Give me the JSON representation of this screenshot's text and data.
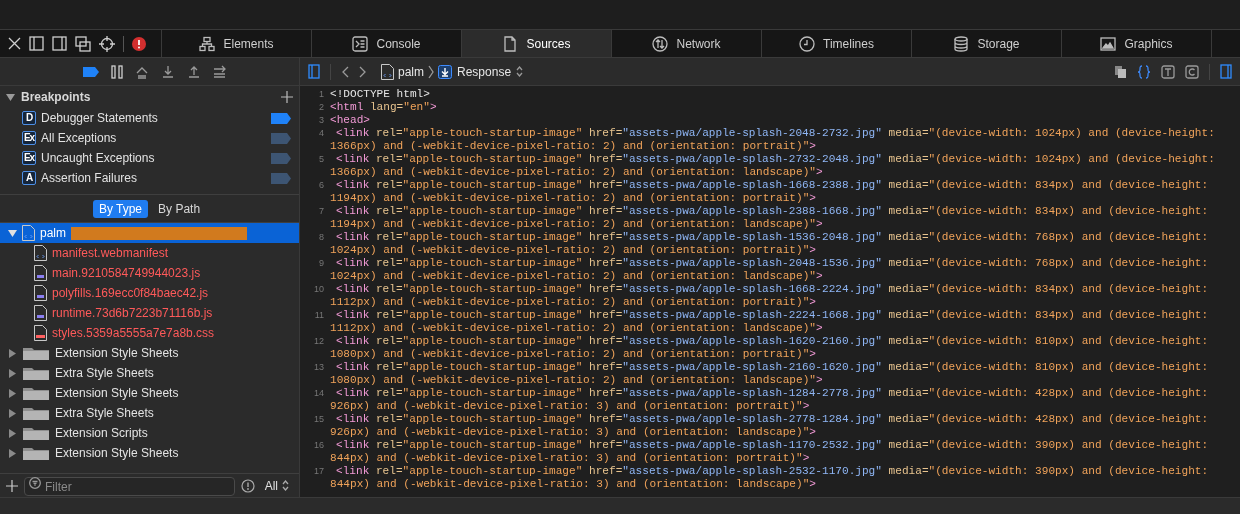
{
  "tabs": [
    {
      "label": "Elements",
      "selected": false
    },
    {
      "label": "Console",
      "selected": false
    },
    {
      "label": "Sources",
      "selected": true
    },
    {
      "label": "Network",
      "selected": false
    },
    {
      "label": "Timelines",
      "selected": false
    },
    {
      "label": "Storage",
      "selected": false
    },
    {
      "label": "Graphics",
      "selected": false
    }
  ],
  "navigation": {
    "breadcrumb": "palm",
    "mode": "Response"
  },
  "breakpoints": {
    "title": "Breakpoints",
    "expanded": true,
    "items": [
      {
        "badge": "D",
        "label": "Debugger Statements",
        "enabled": true
      },
      {
        "badge": "Ex",
        "label": "All Exceptions",
        "enabled": false
      },
      {
        "badge": "Ex",
        "label": "Uncaught Exceptions",
        "enabled": false
      },
      {
        "badge": "A",
        "label": "Assertion Failures",
        "enabled": false
      }
    ]
  },
  "grouping": [
    {
      "label": "By Type",
      "selected": true
    },
    {
      "label": "By Path",
      "selected": false
    }
  ],
  "tree": [
    {
      "label": "palm",
      "kind": "html",
      "selected": true,
      "expanded": true,
      "children": [
        {
          "label": "manifest.webmanifest",
          "kind": "html"
        },
        {
          "label": "main.9210584749944023.js",
          "kind": "js"
        },
        {
          "label": "polyfills.169ecc0f84baec42.js",
          "kind": "js"
        },
        {
          "label": "runtime.73d6b7223b71116b.js",
          "kind": "js"
        },
        {
          "label": "styles.5359a5555a7e7a8b.css",
          "kind": "css"
        }
      ]
    },
    {
      "label": "Extension Style Sheets",
      "kind": "folder",
      "selected": false,
      "expanded": false
    },
    {
      "label": "Extra Style Sheets",
      "kind": "folder",
      "selected": false,
      "expanded": false
    },
    {
      "label": "Extension Style Sheets",
      "kind": "folder",
      "selected": false,
      "expanded": false
    },
    {
      "label": "Extra Style Sheets",
      "kind": "folder",
      "selected": false,
      "expanded": false
    },
    {
      "label": "Extension Scripts",
      "kind": "folder",
      "selected": false,
      "expanded": false
    },
    {
      "label": "Extension Style Sheets",
      "kind": "folder",
      "selected": false,
      "expanded": false
    }
  ],
  "filter": {
    "placeholder": "Filter",
    "scope": "All"
  },
  "code": [
    {
      "number": "1",
      "kind": "plain",
      "rows": [
        {
          "segments": [
            {
              "kind": "plain",
              "text": "<!DOCTYPE html>"
            }
          ]
        }
      ]
    },
    {
      "number": "2",
      "kind": "plain",
      "rows": [
        {
          "segments": [
            {
              "kind": "tag",
              "text": "<html"
            },
            {
              "kind": "attribute",
              "text": " lang="
            },
            {
              "kind": "string",
              "text": "\"en\""
            },
            {
              "kind": "tag",
              "text": ">"
            }
          ]
        }
      ]
    },
    {
      "number": "3",
      "kind": "plain",
      "rows": [
        {
          "segments": [
            {
              "kind": "tag",
              "text": "<head>"
            }
          ]
        }
      ]
    },
    {
      "number": "4",
      "kind": "link",
      "rows": [
        {
          "segments": [
            {
              "kind": "tag",
              "text": "<link"
            },
            {
              "kind": "attribute",
              "text": " rel="
            },
            {
              "kind": "string",
              "text": "\"apple-touch-startup-image\""
            },
            {
              "kind": "attribute",
              "text": " href="
            },
            {
              "kind": "url",
              "text": "\"assets-pwa/apple-splash-2048-2732.jpg\""
            },
            {
              "kind": "attribute",
              "text": " media="
            },
            {
              "kind": "string",
              "text": "\"(device-width: 1024px) and (device-height:"
            }
          ]
        },
        {
          "segments": [
            {
              "kind": "string",
              "text": "1366px) and (-webkit-device-pixel-ratio: 2) and (orientation: portrait)\""
            },
            {
              "kind": "tag",
              "text": ">"
            }
          ]
        }
      ]
    },
    {
      "number": "5",
      "kind": "link",
      "rows": [
        {
          "segments": [
            {
              "kind": "tag",
              "text": "<link"
            },
            {
              "kind": "attribute",
              "text": " rel="
            },
            {
              "kind": "string",
              "text": "\"apple-touch-startup-image\""
            },
            {
              "kind": "attribute",
              "text": " href="
            },
            {
              "kind": "url",
              "text": "\"assets-pwa/apple-splash-2732-2048.jpg\""
            },
            {
              "kind": "attribute",
              "text": " media="
            },
            {
              "kind": "string",
              "text": "\"(device-width: 1024px) and (device-height:"
            }
          ]
        },
        {
          "segments": [
            {
              "kind": "string",
              "text": "1366px) and (-webkit-device-pixel-ratio: 2) and (orientation: landscape)\""
            },
            {
              "kind": "tag",
              "text": ">"
            }
          ]
        }
      ]
    },
    {
      "number": "6",
      "kind": "link",
      "rows": [
        {
          "segments": [
            {
              "kind": "tag",
              "text": "<link"
            },
            {
              "kind": "attribute",
              "text": " rel="
            },
            {
              "kind": "string",
              "text": "\"apple-touch-startup-image\""
            },
            {
              "kind": "attribute",
              "text": " href="
            },
            {
              "kind": "url",
              "text": "\"assets-pwa/apple-splash-1668-2388.jpg\""
            },
            {
              "kind": "attribute",
              "text": " media="
            },
            {
              "kind": "string",
              "text": "\"(device-width: 834px) and (device-height:"
            }
          ]
        },
        {
          "segments": [
            {
              "kind": "string",
              "text": "1194px) and (-webkit-device-pixel-ratio: 2) and (orientation: portrait)\""
            },
            {
              "kind": "tag",
              "text": ">"
            }
          ]
        }
      ]
    },
    {
      "number": "7",
      "kind": "link",
      "rows": [
        {
          "segments": [
            {
              "kind": "tag",
              "text": "<link"
            },
            {
              "kind": "attribute",
              "text": " rel="
            },
            {
              "kind": "string",
              "text": "\"apple-touch-startup-image\""
            },
            {
              "kind": "attribute",
              "text": " href="
            },
            {
              "kind": "url",
              "text": "\"assets-pwa/apple-splash-2388-1668.jpg\""
            },
            {
              "kind": "attribute",
              "text": " media="
            },
            {
              "kind": "string",
              "text": "\"(device-width: 834px) and (device-height:"
            }
          ]
        },
        {
          "segments": [
            {
              "kind": "string",
              "text": "1194px) and (-webkit-device-pixel-ratio: 2) and (orientation: landscape)\""
            },
            {
              "kind": "tag",
              "text": ">"
            }
          ]
        }
      ]
    },
    {
      "number": "8",
      "kind": "link",
      "rows": [
        {
          "segments": [
            {
              "kind": "tag",
              "text": "<link"
            },
            {
              "kind": "attribute",
              "text": " rel="
            },
            {
              "kind": "string",
              "text": "\"apple-touch-startup-image\""
            },
            {
              "kind": "attribute",
              "text": " href="
            },
            {
              "kind": "url",
              "text": "\"assets-pwa/apple-splash-1536-2048.jpg\""
            },
            {
              "kind": "attribute",
              "text": " media="
            },
            {
              "kind": "string",
              "text": "\"(device-width: 768px) and (device-height:"
            }
          ]
        },
        {
          "segments": [
            {
              "kind": "string",
              "text": "1024px) and (-webkit-device-pixel-ratio: 2) and (orientation: portrait)\""
            },
            {
              "kind": "tag",
              "text": ">"
            }
          ]
        }
      ]
    },
    {
      "number": "9",
      "kind": "link",
      "rows": [
        {
          "segments": [
            {
              "kind": "tag",
              "text": "<link"
            },
            {
              "kind": "attribute",
              "text": " rel="
            },
            {
              "kind": "string",
              "text": "\"apple-touch-startup-image\""
            },
            {
              "kind": "attribute",
              "text": " href="
            },
            {
              "kind": "url",
              "text": "\"assets-pwa/apple-splash-2048-1536.jpg\""
            },
            {
              "kind": "attribute",
              "text": " media="
            },
            {
              "kind": "string",
              "text": "\"(device-width: 768px) and (device-height:"
            }
          ]
        },
        {
          "segments": [
            {
              "kind": "string",
              "text": "1024px) and (-webkit-device-pixel-ratio: 2) and (orientation: landscape)\""
            },
            {
              "kind": "tag",
              "text": ">"
            }
          ]
        }
      ]
    },
    {
      "number": "10",
      "kind": "link",
      "rows": [
        {
          "segments": [
            {
              "kind": "tag",
              "text": "<link"
            },
            {
              "kind": "attribute",
              "text": " rel="
            },
            {
              "kind": "string",
              "text": "\"apple-touch-startup-image\""
            },
            {
              "kind": "attribute",
              "text": " href="
            },
            {
              "kind": "url",
              "text": "\"assets-pwa/apple-splash-1668-2224.jpg\""
            },
            {
              "kind": "attribute",
              "text": " media="
            },
            {
              "kind": "string",
              "text": "\"(device-width: 834px) and (device-height:"
            }
          ]
        },
        {
          "segments": [
            {
              "kind": "string",
              "text": "1112px) and (-webkit-device-pixel-ratio: 2) and (orientation: portrait)\""
            },
            {
              "kind": "tag",
              "text": ">"
            }
          ]
        }
      ]
    },
    {
      "number": "11",
      "kind": "link",
      "rows": [
        {
          "segments": [
            {
              "kind": "tag",
              "text": "<link"
            },
            {
              "kind": "attribute",
              "text": " rel="
            },
            {
              "kind": "string",
              "text": "\"apple-touch-startup-image\""
            },
            {
              "kind": "attribute",
              "text": " href="
            },
            {
              "kind": "url",
              "text": "\"assets-pwa/apple-splash-2224-1668.jpg\""
            },
            {
              "kind": "attribute",
              "text": " media="
            },
            {
              "kind": "string",
              "text": "\"(device-width: 834px) and (device-height:"
            }
          ]
        },
        {
          "segments": [
            {
              "kind": "string",
              "text": "1112px) and (-webkit-device-pixel-ratio: 2) and (orientation: landscape)\""
            },
            {
              "kind": "tag",
              "text": ">"
            }
          ]
        }
      ]
    },
    {
      "number": "12",
      "kind": "link",
      "rows": [
        {
          "segments": [
            {
              "kind": "tag",
              "text": "<link"
            },
            {
              "kind": "attribute",
              "text": " rel="
            },
            {
              "kind": "string",
              "text": "\"apple-touch-startup-image\""
            },
            {
              "kind": "attribute",
              "text": " href="
            },
            {
              "kind": "url",
              "text": "\"assets-pwa/apple-splash-1620-2160.jpg\""
            },
            {
              "kind": "attribute",
              "text": " media="
            },
            {
              "kind": "string",
              "text": "\"(device-width: 810px) and (device-height:"
            }
          ]
        },
        {
          "segments": [
            {
              "kind": "string",
              "text": "1080px) and (-webkit-device-pixel-ratio: 2) and (orientation: portrait)\""
            },
            {
              "kind": "tag",
              "text": ">"
            }
          ]
        }
      ]
    },
    {
      "number": "13",
      "kind": "link",
      "rows": [
        {
          "segments": [
            {
              "kind": "tag",
              "text": "<link"
            },
            {
              "kind": "attribute",
              "text": " rel="
            },
            {
              "kind": "string",
              "text": "\"apple-touch-startup-image\""
            },
            {
              "kind": "attribute",
              "text": " href="
            },
            {
              "kind": "url",
              "text": "\"assets-pwa/apple-splash-2160-1620.jpg\""
            },
            {
              "kind": "attribute",
              "text": " media="
            },
            {
              "kind": "string",
              "text": "\"(device-width: 810px) and (device-height:"
            }
          ]
        },
        {
          "segments": [
            {
              "kind": "string",
              "text": "1080px) and (-webkit-device-pixel-ratio: 2) and (orientation: landscape)\""
            },
            {
              "kind": "tag",
              "text": ">"
            }
          ]
        }
      ]
    },
    {
      "number": "14",
      "kind": "link",
      "rows": [
        {
          "segments": [
            {
              "kind": "tag",
              "text": "<link"
            },
            {
              "kind": "attribute",
              "text": " rel="
            },
            {
              "kind": "string",
              "text": "\"apple-touch-startup-image\""
            },
            {
              "kind": "attribute",
              "text": " href="
            },
            {
              "kind": "url",
              "text": "\"assets-pwa/apple-splash-1284-2778.jpg\""
            },
            {
              "kind": "attribute",
              "text": " media="
            },
            {
              "kind": "string",
              "text": "\"(device-width: 428px) and (device-height:"
            }
          ]
        },
        {
          "segments": [
            {
              "kind": "string",
              "text": "926px) and (-webkit-device-pixel-ratio: 3) and (orientation: portrait)\""
            },
            {
              "kind": "tag",
              "text": ">"
            }
          ]
        }
      ]
    },
    {
      "number": "15",
      "kind": "link",
      "rows": [
        {
          "segments": [
            {
              "kind": "tag",
              "text": "<link"
            },
            {
              "kind": "attribute",
              "text": " rel="
            },
            {
              "kind": "string",
              "text": "\"apple-touch-startup-image\""
            },
            {
              "kind": "attribute",
              "text": " href="
            },
            {
              "kind": "url",
              "text": "\"assets-pwa/apple-splash-2778-1284.jpg\""
            },
            {
              "kind": "attribute",
              "text": " media="
            },
            {
              "kind": "string",
              "text": "\"(device-width: 428px) and (device-height:"
            }
          ]
        },
        {
          "segments": [
            {
              "kind": "string",
              "text": "926px) and (-webkit-device-pixel-ratio: 3) and (orientation: landscape)\""
            },
            {
              "kind": "tag",
              "text": ">"
            }
          ]
        }
      ]
    },
    {
      "number": "16",
      "kind": "link",
      "rows": [
        {
          "segments": [
            {
              "kind": "tag",
              "text": "<link"
            },
            {
              "kind": "attribute",
              "text": " rel="
            },
            {
              "kind": "string",
              "text": "\"apple-touch-startup-image\""
            },
            {
              "kind": "attribute",
              "text": " href="
            },
            {
              "kind": "url",
              "text": "\"assets-pwa/apple-splash-1170-2532.jpg\""
            },
            {
              "kind": "attribute",
              "text": " media="
            },
            {
              "kind": "string",
              "text": "\"(device-width: 390px) and (device-height:"
            }
          ]
        },
        {
          "segments": [
            {
              "kind": "string",
              "text": "844px) and (-webkit-device-pixel-ratio: 3) and (orientation: portrait)\""
            },
            {
              "kind": "tag",
              "text": ">"
            }
          ]
        }
      ]
    },
    {
      "number": "17",
      "kind": "link",
      "rows": [
        {
          "segments": [
            {
              "kind": "tag",
              "text": "<link"
            },
            {
              "kind": "attribute",
              "text": " rel="
            },
            {
              "kind": "string",
              "text": "\"apple-touch-startup-image\""
            },
            {
              "kind": "attribute",
              "text": " href="
            },
            {
              "kind": "url",
              "text": "\"assets-pwa/apple-splash-2532-1170.jpg\""
            },
            {
              "kind": "attribute",
              "text": " media="
            },
            {
              "kind": "string",
              "text": "\"(device-width: 390px) and (device-height:"
            }
          ]
        },
        {
          "segments": [
            {
              "kind": "string",
              "text": "844px) and (-webkit-device-pixel-ratio: 3) and (orientation: landscape)\""
            },
            {
              "kind": "tag",
              "text": ">"
            }
          ]
        }
      ]
    }
  ]
}
